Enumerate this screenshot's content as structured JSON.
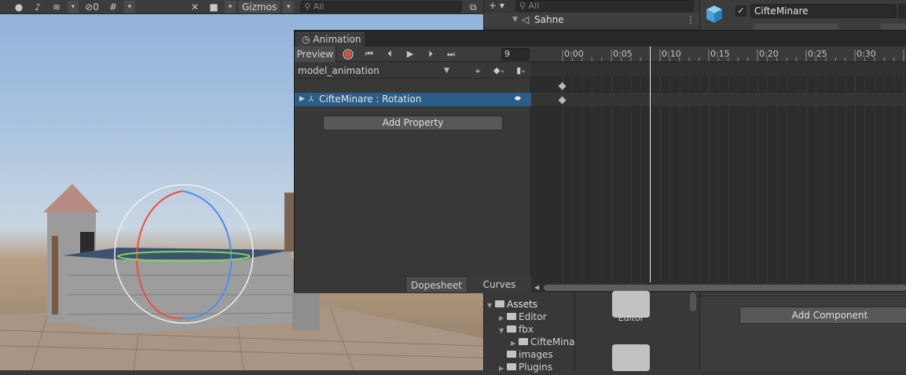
{
  "scene_toolbar": {
    "hidden_count": "0",
    "gizmos_label": "Gizmos",
    "search_placeholder": "All"
  },
  "hierarchy": {
    "search_placeholder": "All",
    "scene_name": "Sahne"
  },
  "inspector": {
    "object_name": "CifteMinare",
    "add_component_label": "Add Component"
  },
  "animation": {
    "tab_label": "Animation",
    "preview_label": "Preview",
    "frame_value": "9",
    "clip_name": "model_animation",
    "property_label": "CifteMinare : Rotation",
    "add_property_label": "Add Property",
    "dopesheet_label": "Dopesheet",
    "curves_label": "Curves",
    "ruler_labels": [
      "0:00",
      "0:05",
      "0:10",
      "0:15",
      "0:20",
      "0:25",
      "0:30"
    ]
  },
  "project": {
    "tree": [
      {
        "label": "Assets",
        "depth": 0,
        "expanded": true
      },
      {
        "label": "Editor",
        "depth": 1,
        "expanded": false
      },
      {
        "label": "fbx",
        "depth": 1,
        "expanded": true
      },
      {
        "label": "CifteMina",
        "depth": 2,
        "expanded": false
      },
      {
        "label": "images",
        "depth": 1,
        "expanded": null
      },
      {
        "label": "Plugins",
        "depth": 1,
        "expanded": false
      }
    ],
    "grid_folder_label": "Editor"
  },
  "colors": {
    "selection": "#2c5d87",
    "record": "#e0533b",
    "gizmo_red": "#e8503a",
    "gizmo_blue": "#4d8ef0",
    "gizmo_green": "#7fd65a"
  }
}
